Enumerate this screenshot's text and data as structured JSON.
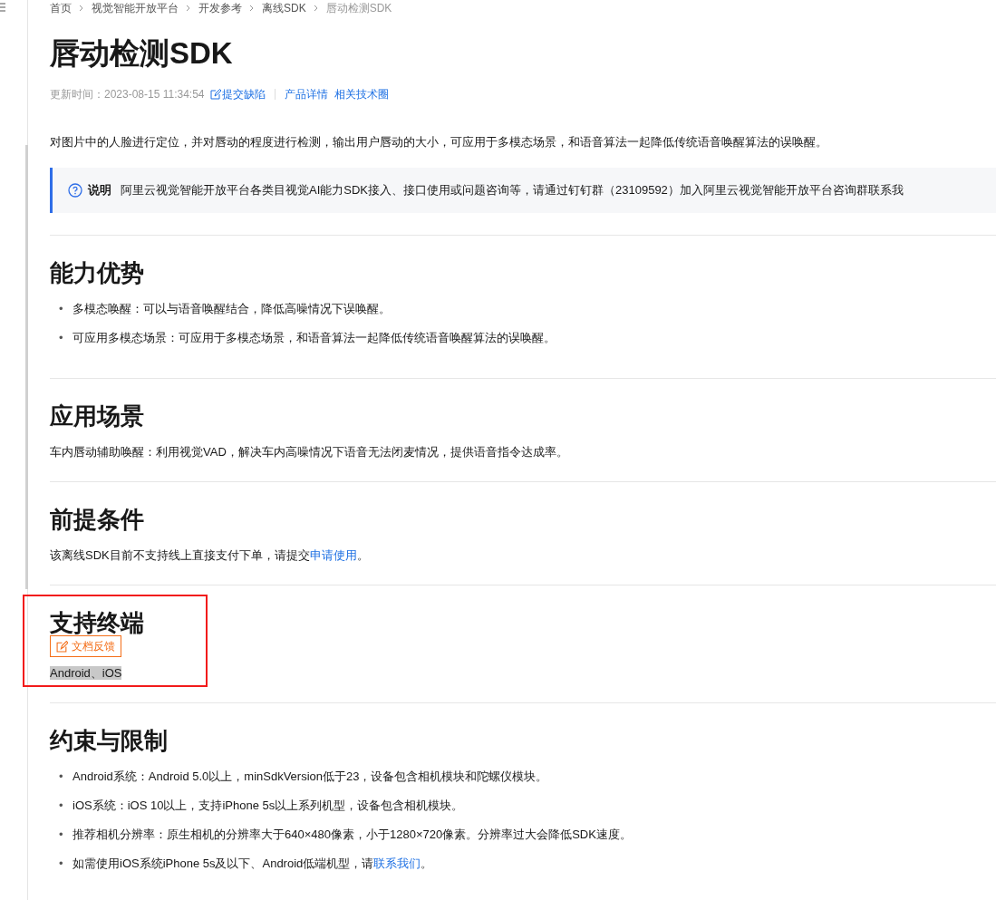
{
  "breadcrumb": [
    "首页",
    "视觉智能开放平台",
    "开发参考",
    "离线SDK",
    "唇动检测SDK"
  ],
  "title": "唇动检测SDK",
  "meta": {
    "updated": "更新时间：2023-08-15 11:34:54",
    "links": [
      "提交缺陷",
      "产品详情",
      "相关技术圈"
    ]
  },
  "intro": "对图片中的人脸进行定位，并对唇动的程度进行检测，输出用户唇动的大小，可应用于多模态场景，和语音算法一起降低传统语音唤醒算法的误唤醒。",
  "note": {
    "label": "说明",
    "text": "阿里云视觉智能开放平台各类目视觉AI能力SDK接入、接口使用或问题咨询等，请通过钉钉群（23109592）加入阿里云视觉智能开放平台咨询群联系我"
  },
  "sections": [
    {
      "heading": "能力优势",
      "kind": "bullets",
      "annotated": false,
      "items": [
        {
          "bullet": "•",
          "segments": [
            {
              "kind": "text",
              "text": "多模态唤醒：可以与语音唤醒结合，降低高噪情况下误唤醒。"
            }
          ]
        },
        {
          "bullet": "•",
          "segments": [
            {
              "kind": "text",
              "text": "可应用多模态场景：可应用于多模态场景，和语音算法一起降低传统语音唤醒算法的误唤醒。"
            }
          ]
        }
      ]
    },
    {
      "heading": "应用场景",
      "kind": "paragraph",
      "annotated": false,
      "highlighted": false,
      "segments": [
        {
          "kind": "text",
          "text": "车内唇动辅助唤醒：利用视觉VAD，解决车内高噪情况下语音无法闭麦情况，提供语音指令达成率。"
        }
      ]
    },
    {
      "heading": "前提条件",
      "kind": "paragraph",
      "annotated": false,
      "highlighted": false,
      "segments": [
        {
          "kind": "text",
          "text": "该离线SDK目前不支持线上直接支付下单，请提交"
        },
        {
          "kind": "link",
          "text": "申请使用"
        },
        {
          "kind": "text",
          "text": "。"
        }
      ]
    },
    {
      "heading": "支持终端",
      "kind": "paragraph",
      "annotated": true,
      "feedback_button": "文档反馈",
      "highlighted": true,
      "segments": [
        {
          "kind": "text",
          "text": "Android、iOS"
        }
      ]
    },
    {
      "heading": "约束与限制",
      "kind": "bullets",
      "annotated": false,
      "items": [
        {
          "bullet": "•",
          "segments": [
            {
              "kind": "text",
              "text": "Android系统：Android 5.0以上，minSdkVersion低于23，设备包含相机模块和陀螺仪模块。"
            }
          ]
        },
        {
          "bullet": "•",
          "segments": [
            {
              "kind": "text",
              "text": "iOS系统：iOS 10以上，支持iPhone 5s以上系列机型，设备包含相机模块。"
            }
          ]
        },
        {
          "bullet": "•",
          "segments": [
            {
              "kind": "text",
              "text": "推荐相机分辨率：原生相机的分辨率大于640×480像素，小于1280×720像素。分辨率过大会降低SDK速度。"
            }
          ]
        },
        {
          "bullet": "•",
          "segments": [
            {
              "kind": "text",
              "text": "如需使用iOS系统iPhone 5s及以下、Android低端机型，请"
            },
            {
              "kind": "link",
              "text": "联系我们"
            },
            {
              "kind": "text",
              "text": "。"
            }
          ]
        }
      ]
    }
  ]
}
